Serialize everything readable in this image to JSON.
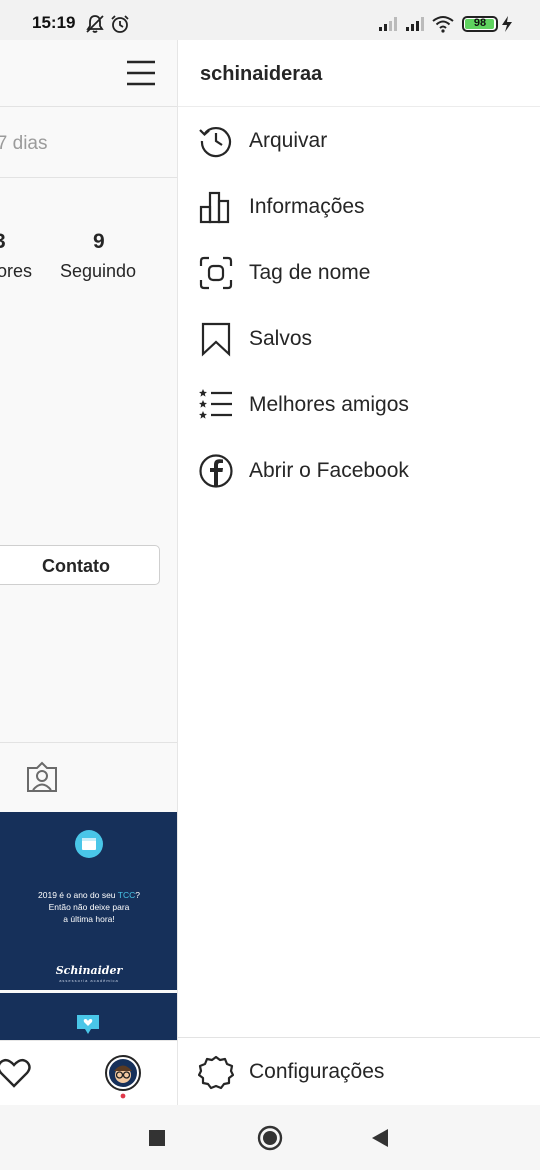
{
  "status_bar": {
    "time": "15:19",
    "battery_level": "98",
    "battery_fraction": 0.98,
    "icons": [
      "bell-muted-icon",
      "alarm-icon",
      "signal-icon",
      "signal-icon",
      "wifi-icon",
      "battery-icon",
      "charging-icon"
    ]
  },
  "profile_background": {
    "subtitle_fragment": "s 7 dias",
    "followers_num_fragment": "3",
    "followers_label_fragment": "ores",
    "following_num": "9",
    "following_label": "Seguindo",
    "contact_button": "Contato",
    "post1": {
      "line1_pre": "2019 é o ano do seu ",
      "line1_hl": "TCC",
      "line1_post": "?",
      "line2": "Então não deixe para",
      "line3": "a última hora!",
      "brand": "Schinaider",
      "brand_sub": "assessoria acadêmica"
    },
    "icons": [
      "tagged-photos-icon",
      "heart-icon",
      "profile-avatar"
    ]
  },
  "drawer": {
    "username": "schinaideraa",
    "items": [
      {
        "label": "Arquivar",
        "icon": "archive-history-icon"
      },
      {
        "label": "Informações",
        "icon": "insights-bar-chart-icon"
      },
      {
        "label": "Tag de nome",
        "icon": "nametag-icon"
      },
      {
        "label": "Salvos",
        "icon": "bookmark-icon"
      },
      {
        "label": "Melhores amigos",
        "icon": "close-friends-list-icon"
      },
      {
        "label": "Abrir o Facebook",
        "icon": "facebook-icon"
      }
    ],
    "settings_label": "Configurações",
    "settings_icon": "settings-gear-icon"
  },
  "system_nav": {
    "icons": [
      "recents-square-icon",
      "home-circle-icon",
      "back-triangle-icon"
    ]
  },
  "colors": {
    "accent_post": "#16305a",
    "highlight": "#49c6e8",
    "battery": "#5fd35f",
    "notification_dot": "#e0394a"
  }
}
